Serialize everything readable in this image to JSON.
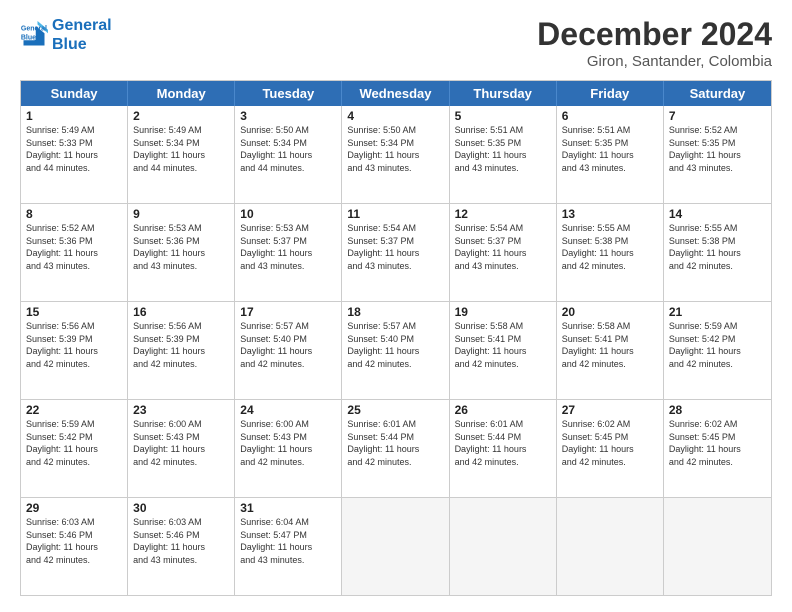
{
  "logo": {
    "line1": "General",
    "line2": "Blue"
  },
  "title": "December 2024",
  "subtitle": "Giron, Santander, Colombia",
  "header_days": [
    "Sunday",
    "Monday",
    "Tuesday",
    "Wednesday",
    "Thursday",
    "Friday",
    "Saturday"
  ],
  "weeks": [
    [
      {
        "day": "1",
        "lines": [
          "Sunrise: 5:49 AM",
          "Sunset: 5:33 PM",
          "Daylight: 11 hours",
          "and 44 minutes."
        ]
      },
      {
        "day": "2",
        "lines": [
          "Sunrise: 5:49 AM",
          "Sunset: 5:34 PM",
          "Daylight: 11 hours",
          "and 44 minutes."
        ]
      },
      {
        "day": "3",
        "lines": [
          "Sunrise: 5:50 AM",
          "Sunset: 5:34 PM",
          "Daylight: 11 hours",
          "and 44 minutes."
        ]
      },
      {
        "day": "4",
        "lines": [
          "Sunrise: 5:50 AM",
          "Sunset: 5:34 PM",
          "Daylight: 11 hours",
          "and 43 minutes."
        ]
      },
      {
        "day": "5",
        "lines": [
          "Sunrise: 5:51 AM",
          "Sunset: 5:35 PM",
          "Daylight: 11 hours",
          "and 43 minutes."
        ]
      },
      {
        "day": "6",
        "lines": [
          "Sunrise: 5:51 AM",
          "Sunset: 5:35 PM",
          "Daylight: 11 hours",
          "and 43 minutes."
        ]
      },
      {
        "day": "7",
        "lines": [
          "Sunrise: 5:52 AM",
          "Sunset: 5:35 PM",
          "Daylight: 11 hours",
          "and 43 minutes."
        ]
      }
    ],
    [
      {
        "day": "8",
        "lines": [
          "Sunrise: 5:52 AM",
          "Sunset: 5:36 PM",
          "Daylight: 11 hours",
          "and 43 minutes."
        ]
      },
      {
        "day": "9",
        "lines": [
          "Sunrise: 5:53 AM",
          "Sunset: 5:36 PM",
          "Daylight: 11 hours",
          "and 43 minutes."
        ]
      },
      {
        "day": "10",
        "lines": [
          "Sunrise: 5:53 AM",
          "Sunset: 5:37 PM",
          "Daylight: 11 hours",
          "and 43 minutes."
        ]
      },
      {
        "day": "11",
        "lines": [
          "Sunrise: 5:54 AM",
          "Sunset: 5:37 PM",
          "Daylight: 11 hours",
          "and 43 minutes."
        ]
      },
      {
        "day": "12",
        "lines": [
          "Sunrise: 5:54 AM",
          "Sunset: 5:37 PM",
          "Daylight: 11 hours",
          "and 43 minutes."
        ]
      },
      {
        "day": "13",
        "lines": [
          "Sunrise: 5:55 AM",
          "Sunset: 5:38 PM",
          "Daylight: 11 hours",
          "and 42 minutes."
        ]
      },
      {
        "day": "14",
        "lines": [
          "Sunrise: 5:55 AM",
          "Sunset: 5:38 PM",
          "Daylight: 11 hours",
          "and 42 minutes."
        ]
      }
    ],
    [
      {
        "day": "15",
        "lines": [
          "Sunrise: 5:56 AM",
          "Sunset: 5:39 PM",
          "Daylight: 11 hours",
          "and 42 minutes."
        ]
      },
      {
        "day": "16",
        "lines": [
          "Sunrise: 5:56 AM",
          "Sunset: 5:39 PM",
          "Daylight: 11 hours",
          "and 42 minutes."
        ]
      },
      {
        "day": "17",
        "lines": [
          "Sunrise: 5:57 AM",
          "Sunset: 5:40 PM",
          "Daylight: 11 hours",
          "and 42 minutes."
        ]
      },
      {
        "day": "18",
        "lines": [
          "Sunrise: 5:57 AM",
          "Sunset: 5:40 PM",
          "Daylight: 11 hours",
          "and 42 minutes."
        ]
      },
      {
        "day": "19",
        "lines": [
          "Sunrise: 5:58 AM",
          "Sunset: 5:41 PM",
          "Daylight: 11 hours",
          "and 42 minutes."
        ]
      },
      {
        "day": "20",
        "lines": [
          "Sunrise: 5:58 AM",
          "Sunset: 5:41 PM",
          "Daylight: 11 hours",
          "and 42 minutes."
        ]
      },
      {
        "day": "21",
        "lines": [
          "Sunrise: 5:59 AM",
          "Sunset: 5:42 PM",
          "Daylight: 11 hours",
          "and 42 minutes."
        ]
      }
    ],
    [
      {
        "day": "22",
        "lines": [
          "Sunrise: 5:59 AM",
          "Sunset: 5:42 PM",
          "Daylight: 11 hours",
          "and 42 minutes."
        ]
      },
      {
        "day": "23",
        "lines": [
          "Sunrise: 6:00 AM",
          "Sunset: 5:43 PM",
          "Daylight: 11 hours",
          "and 42 minutes."
        ]
      },
      {
        "day": "24",
        "lines": [
          "Sunrise: 6:00 AM",
          "Sunset: 5:43 PM",
          "Daylight: 11 hours",
          "and 42 minutes."
        ]
      },
      {
        "day": "25",
        "lines": [
          "Sunrise: 6:01 AM",
          "Sunset: 5:44 PM",
          "Daylight: 11 hours",
          "and 42 minutes."
        ]
      },
      {
        "day": "26",
        "lines": [
          "Sunrise: 6:01 AM",
          "Sunset: 5:44 PM",
          "Daylight: 11 hours",
          "and 42 minutes."
        ]
      },
      {
        "day": "27",
        "lines": [
          "Sunrise: 6:02 AM",
          "Sunset: 5:45 PM",
          "Daylight: 11 hours",
          "and 42 minutes."
        ]
      },
      {
        "day": "28",
        "lines": [
          "Sunrise: 6:02 AM",
          "Sunset: 5:45 PM",
          "Daylight: 11 hours",
          "and 42 minutes."
        ]
      }
    ],
    [
      {
        "day": "29",
        "lines": [
          "Sunrise: 6:03 AM",
          "Sunset: 5:46 PM",
          "Daylight: 11 hours",
          "and 42 minutes."
        ]
      },
      {
        "day": "30",
        "lines": [
          "Sunrise: 6:03 AM",
          "Sunset: 5:46 PM",
          "Daylight: 11 hours",
          "and 43 minutes."
        ]
      },
      {
        "day": "31",
        "lines": [
          "Sunrise: 6:04 AM",
          "Sunset: 5:47 PM",
          "Daylight: 11 hours",
          "and 43 minutes."
        ]
      },
      {
        "day": "",
        "lines": []
      },
      {
        "day": "",
        "lines": []
      },
      {
        "day": "",
        "lines": []
      },
      {
        "day": "",
        "lines": []
      }
    ]
  ]
}
